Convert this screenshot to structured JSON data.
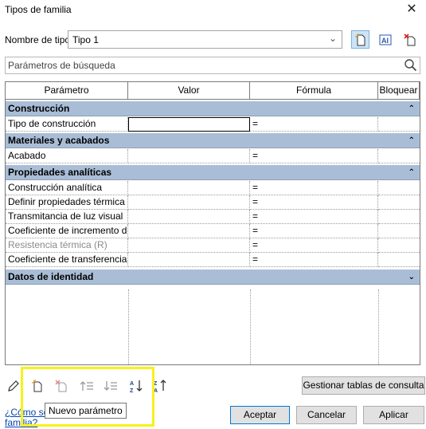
{
  "window": {
    "title": "Tipos de familia",
    "close_glyph": "✕"
  },
  "type_selector": {
    "label": "Nombre de tipo:",
    "value": "Tipo 1"
  },
  "search": {
    "placeholder": "Parámetros de búsqueda"
  },
  "columns": [
    "Parámetro",
    "Valor",
    "Fórmula",
    "Bloquear"
  ],
  "groups": [
    {
      "name": "Construcción",
      "toggle": "⌃",
      "rows": [
        {
          "param": "Tipo de construcción",
          "value": "",
          "formula": "="
        }
      ]
    },
    {
      "name": "Materiales y acabados",
      "toggle": "⌃",
      "rows": [
        {
          "param": "Acabado",
          "value": "",
          "formula": "="
        }
      ]
    },
    {
      "name": "Propiedades analíticas",
      "toggle": "⌃",
      "rows": [
        {
          "param": "Construcción analítica",
          "value": "",
          "formula": "="
        },
        {
          "param": "Definir propiedades térmica",
          "value": "",
          "formula": "="
        },
        {
          "param": "Transmitancia de luz visual",
          "value": "",
          "formula": "="
        },
        {
          "param": "Coeficiente de incremento d",
          "value": "",
          "formula": "="
        },
        {
          "param": "Resistencia térmica (R)",
          "value": "",
          "formula": "="
        },
        {
          "param": "Coeficiente de transferencia",
          "value": "",
          "formula": "="
        }
      ]
    },
    {
      "name": "Datos de identidad",
      "toggle": "⌄",
      "rows": []
    }
  ],
  "tooltip": "Nuevo parámetro",
  "buttons": {
    "manage_lookup": "Gestionar tablas de consulta",
    "ok": "Aceptar",
    "cancel": "Cancelar",
    "apply": "Aplicar"
  },
  "help_link": {
    "line1": "¿Cómo se",
    "line2": "familia?"
  },
  "icons": {
    "new_type": "new-type-icon",
    "rename_type": "rename-type-icon",
    "delete_type": "delete-type-icon",
    "search": "magnifier-icon",
    "edit": "pencil-icon",
    "new_param": "new-parameter-icon",
    "delete_param": "delete-parameter-icon",
    "move_up": "move-up-icon",
    "move_down": "move-down-icon",
    "sort_asc": "sort-ascending-icon",
    "sort_desc": "sort-descending-icon"
  },
  "colors": {
    "group_header": "#a9bed6",
    "highlight": "#f7f21a",
    "primary_border": "#0078d7"
  }
}
